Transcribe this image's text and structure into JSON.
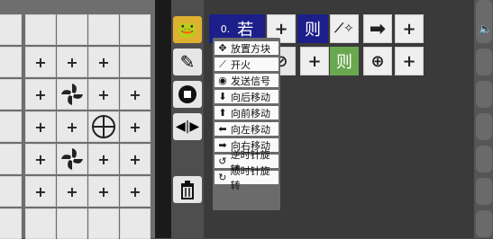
{
  "grid": {
    "plus": "+",
    "cells": [
      [
        "",
        "",
        "",
        "",
        ""
      ],
      [
        "",
        "+",
        "+",
        "+",
        ""
      ],
      [
        "",
        "+",
        "fan",
        "+",
        "+"
      ],
      [
        "",
        "+",
        "+",
        "target",
        "+"
      ],
      [
        "",
        "+",
        "fan",
        "+",
        "+"
      ],
      [
        "",
        "+",
        "+",
        "+",
        "+"
      ],
      [
        "",
        "",
        "",
        "",
        ""
      ]
    ]
  },
  "code": {
    "row1": {
      "index": "0.",
      "if_label": "若",
      "then_label": "则",
      "plus": "+"
    },
    "row2": {
      "then_label": "则",
      "plus": "+"
    }
  },
  "menu": {
    "items": [
      {
        "icon": "move-icon",
        "label": "放置方块"
      },
      {
        "icon": "wand-icon",
        "label": "开火"
      },
      {
        "icon": "signal-icon",
        "label": "发送信号"
      },
      {
        "icon": "arrow-down-icon",
        "label": "向后移动"
      },
      {
        "icon": "arrow-up-icon",
        "label": "向前移动"
      },
      {
        "icon": "arrow-left-icon",
        "label": "向左移动"
      },
      {
        "icon": "arrow-right-icon",
        "label": "向右移动"
      },
      {
        "icon": "rotate-ccw-icon",
        "label": "逆时针旋转"
      },
      {
        "icon": "rotate-cw-icon",
        "label": "顺时针旋转"
      }
    ]
  },
  "colors": {
    "blue": "#1c1f8a",
    "green": "#6aa84f"
  }
}
